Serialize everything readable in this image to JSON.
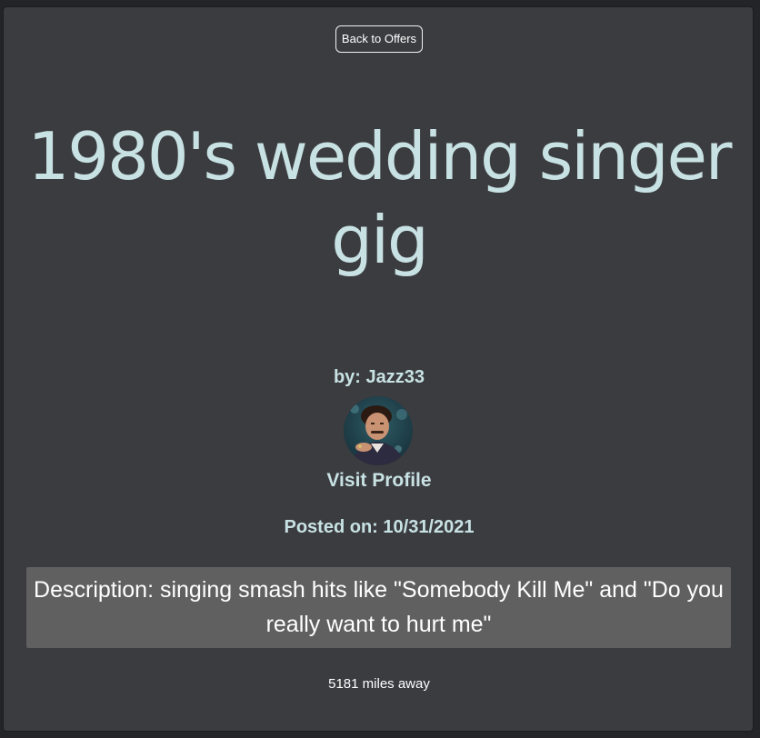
{
  "navigation": {
    "back_label": "Back to Offers"
  },
  "offer": {
    "title": "1980's wedding singer gig",
    "byline": "by: Jazz33",
    "visit_profile_label": "Visit Profile",
    "posted_on": "Posted on: 10/31/2021",
    "description": "Description: singing smash hits like \"Somebody Kill Me\" and \"Do you really want to hurt me\"",
    "distance": "5181 miles away"
  },
  "colors": {
    "page_background": "#232427",
    "card_background": "#3b3c40",
    "heading_text": "#c8e2e4",
    "description_background": "#606060",
    "body_text": "#ffffff"
  },
  "icons": {
    "avatar": "user-profile-photo"
  }
}
